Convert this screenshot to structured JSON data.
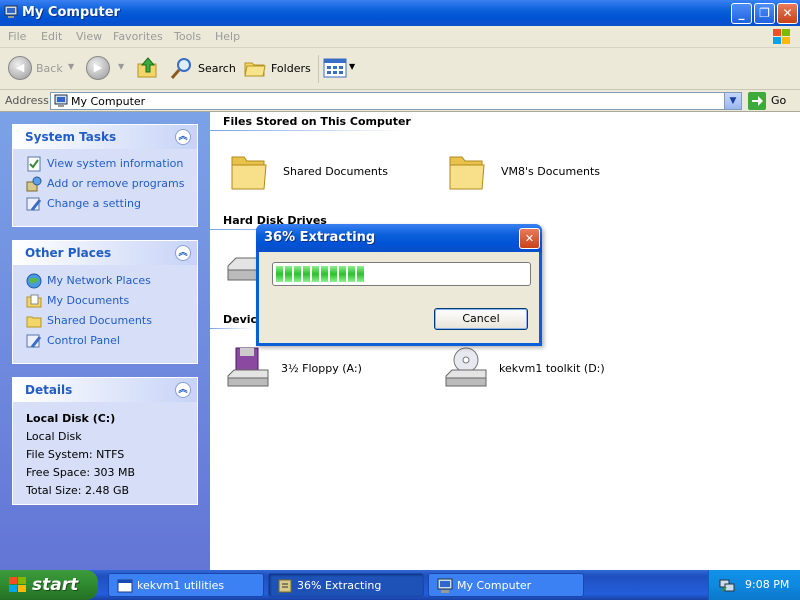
{
  "window": {
    "title": "My Computer"
  },
  "menu": [
    "File",
    "Edit",
    "View",
    "Favorites",
    "Tools",
    "Help"
  ],
  "toolbar": {
    "back_label": "Back",
    "search_label": "Search",
    "folders_label": "Folders"
  },
  "address": {
    "label": "Address",
    "value": "My Computer",
    "go_label": "Go"
  },
  "sidebar": {
    "system_tasks": {
      "title": "System Tasks",
      "items": [
        "View system information",
        "Add or remove programs",
        "Change a setting"
      ]
    },
    "other_places": {
      "title": "Other Places",
      "items": [
        "My Network Places",
        "My Documents",
        "Shared Documents",
        "Control Panel"
      ]
    },
    "details": {
      "title": "Details",
      "name": "Local Disk (C:)",
      "type": "Local Disk",
      "file_system": "File System: NTFS",
      "free_space": "Free Space: 303 MB",
      "total_size": "Total Size: 2.48 GB"
    }
  },
  "content": {
    "files_group": "Files Stored on This Computer",
    "files": [
      "Shared Documents",
      "VM8's Documents"
    ],
    "disks_group": "Hard Disk Drives",
    "removable_group": "Devices with Removable Storage",
    "removable_group_visible": "Device",
    "removable": [
      "3½ Floppy (A:)",
      "kekvm1 toolkit (D:)"
    ]
  },
  "dialog": {
    "title": "36% Extracting",
    "progress_fraction": 0.36,
    "cancel_label": "Cancel"
  },
  "taskbar": {
    "start_label": "start",
    "tasks": [
      "kekvm1 utilities",
      "36% Extracting",
      "My Computer"
    ],
    "clock": "9:08 PM"
  },
  "colors": {
    "title_blue": "#0a5fd8",
    "sidebar_blue": "#6375d6",
    "link_blue": "#215dc6",
    "progress_green": "#2bc02b",
    "start_green": "#2f8a2f"
  }
}
